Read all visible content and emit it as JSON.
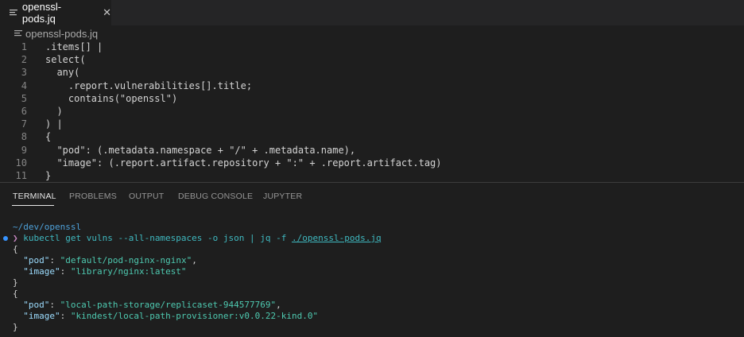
{
  "tab": {
    "title": "openssl-pods.jq",
    "close_glyph": "✕"
  },
  "breadcrumb": {
    "file": "openssl-pods.jq"
  },
  "editor": {
    "lines": [
      {
        "num": "1",
        "text": ".items[] |"
      },
      {
        "num": "2",
        "text": "select("
      },
      {
        "num": "3",
        "text": "  any("
      },
      {
        "num": "4",
        "text": "    .report.vulnerabilities[].title;"
      },
      {
        "num": "5",
        "text": "    contains(\"openssl\")"
      },
      {
        "num": "6",
        "text": "  )"
      },
      {
        "num": "7",
        "text": ") |"
      },
      {
        "num": "8",
        "text": "{"
      },
      {
        "num": "9",
        "text": "  \"pod\": (.metadata.namespace + \"/\" + .metadata.name),"
      },
      {
        "num": "10",
        "text": "  \"image\": (.report.artifact.repository + \":\" + .report.artifact.tag)"
      },
      {
        "num": "11",
        "text": "}"
      }
    ]
  },
  "panel": {
    "tabs": [
      "TERMINAL",
      "PROBLEMS",
      "OUTPUT",
      "DEBUG CONSOLE",
      "JUPYTER"
    ],
    "active": "TERMINAL"
  },
  "terminal": {
    "cwd": "~/dev/openssl",
    "prompt_glyph": "❯",
    "command_prefix": "kubectl get vulns --all-namespaces -o json | jq -f ",
    "command_file": "./openssl-pods.jq",
    "output": [
      {
        "open": "{"
      },
      {
        "key": "\"pod\"",
        "value": "\"default/pod-nginx-nginx\"",
        "trail": ","
      },
      {
        "key": "\"image\"",
        "value": "\"library/nginx:latest\"",
        "trail": ""
      },
      {
        "close": "}"
      },
      {
        "open": "{"
      },
      {
        "key": "\"pod\"",
        "value": "\"local-path-storage/replicaset-944577769\"",
        "trail": ","
      },
      {
        "key": "\"image\"",
        "value": "\"kindest/local-path-provisioner:v0.0.22-kind.0\"",
        "trail": ""
      },
      {
        "close": "}"
      }
    ]
  },
  "colors": {
    "background": "#1e1e1e",
    "tab_bar": "#252526",
    "json_key": "#9cdcfe",
    "json_string": "#4ec9b0",
    "command": "#3fb9c0",
    "cwd": "#4ea0d8",
    "prompt": "#c586c0",
    "status_dot": "#3794ff"
  },
  "icons": {
    "file": "file-lines-icon",
    "close": "close-icon",
    "status": "status-dot-icon",
    "prompt": "prompt-chevron-icon"
  }
}
